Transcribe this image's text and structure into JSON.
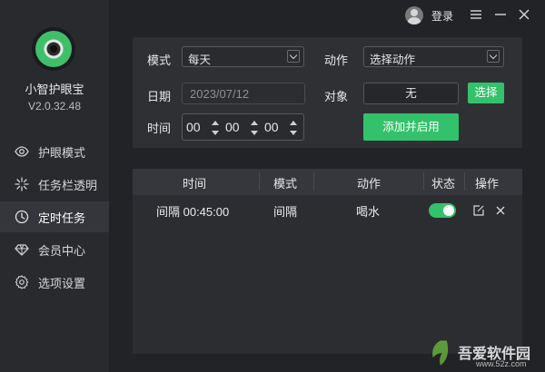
{
  "app": {
    "name": "小智护眼宝",
    "version": "V2.0.32.48"
  },
  "topbar": {
    "login_label": "登录"
  },
  "sidebar": {
    "items": [
      {
        "label": "护眼模式",
        "icon": "eye-icon"
      },
      {
        "label": "任务栏透明",
        "icon": "sparkle-icon"
      },
      {
        "label": "定时任务",
        "icon": "clock-icon",
        "active": true
      },
      {
        "label": "会员中心",
        "icon": "diamond-icon"
      },
      {
        "label": "选项设置",
        "icon": "gear-icon"
      }
    ]
  },
  "form": {
    "mode_label": "模式",
    "mode_value": "每天",
    "action_label": "动作",
    "action_value": "选择动作",
    "date_label": "日期",
    "date_value": "2023/07/12",
    "target_label": "对象",
    "target_value": "无",
    "select_button": "选择",
    "time_label": "时间",
    "time_h": "00",
    "time_m": "00",
    "time_s": "00",
    "add_button": "添加并启用"
  },
  "table": {
    "headers": [
      "时间",
      "模式",
      "动作",
      "状态",
      "操作"
    ],
    "rows": [
      {
        "time": "间隔 00:45:00",
        "mode": "间隔",
        "action": "喝水",
        "enabled": true
      }
    ]
  },
  "watermark": {
    "text": "吾爱软件园",
    "url": "www.52z.com"
  },
  "colors": {
    "accent": "#33c26b",
    "background": "#222327",
    "sidebar": "#292a2e"
  }
}
